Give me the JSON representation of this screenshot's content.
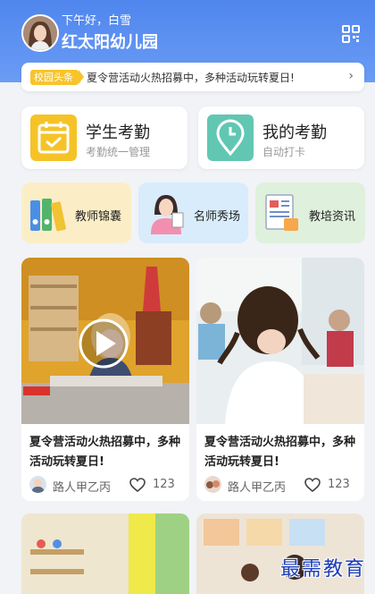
{
  "header": {
    "greeting": "下午好，白雪",
    "school_name": "红太阳幼儿园",
    "qr_icon": "qr-scan-icon"
  },
  "news": {
    "tag": "校园头条",
    "text": "夏令营活动火热招募中，多种活动玩转夏日!",
    "arrow": "›"
  },
  "main_cards": [
    {
      "title": "学生考勤",
      "subtitle": "考勤统一管理",
      "icon": "calendar-check-icon",
      "color": "#f6c327"
    },
    {
      "title": "我的考勤",
      "subtitle": "自动打卡",
      "icon": "clock-pin-icon",
      "color": "#62c7b2"
    }
  ],
  "quick_cards": [
    {
      "label": "教师锦囊",
      "icon": "binders-icon",
      "bg": "#fbeec7"
    },
    {
      "label": "名师秀场",
      "icon": "teacher-icon",
      "bg": "#d9ecfb"
    },
    {
      "label": "教培资讯",
      "icon": "news-report-icon",
      "bg": "#dff0dc"
    }
  ],
  "feed": [
    {
      "text": "夏令营活动火热招募中，多种活动玩转夏日!",
      "author": "路人甲乙丙",
      "likes": "123",
      "has_video": true
    },
    {
      "text": "夏令营活动火热招募中，多种活动玩转夏日!",
      "author": "路人甲乙丙",
      "likes": "123",
      "has_video": false
    }
  ],
  "watermark": "最需教育",
  "colors": {
    "header": "#4f86ee",
    "tag": "#f7c42a"
  }
}
